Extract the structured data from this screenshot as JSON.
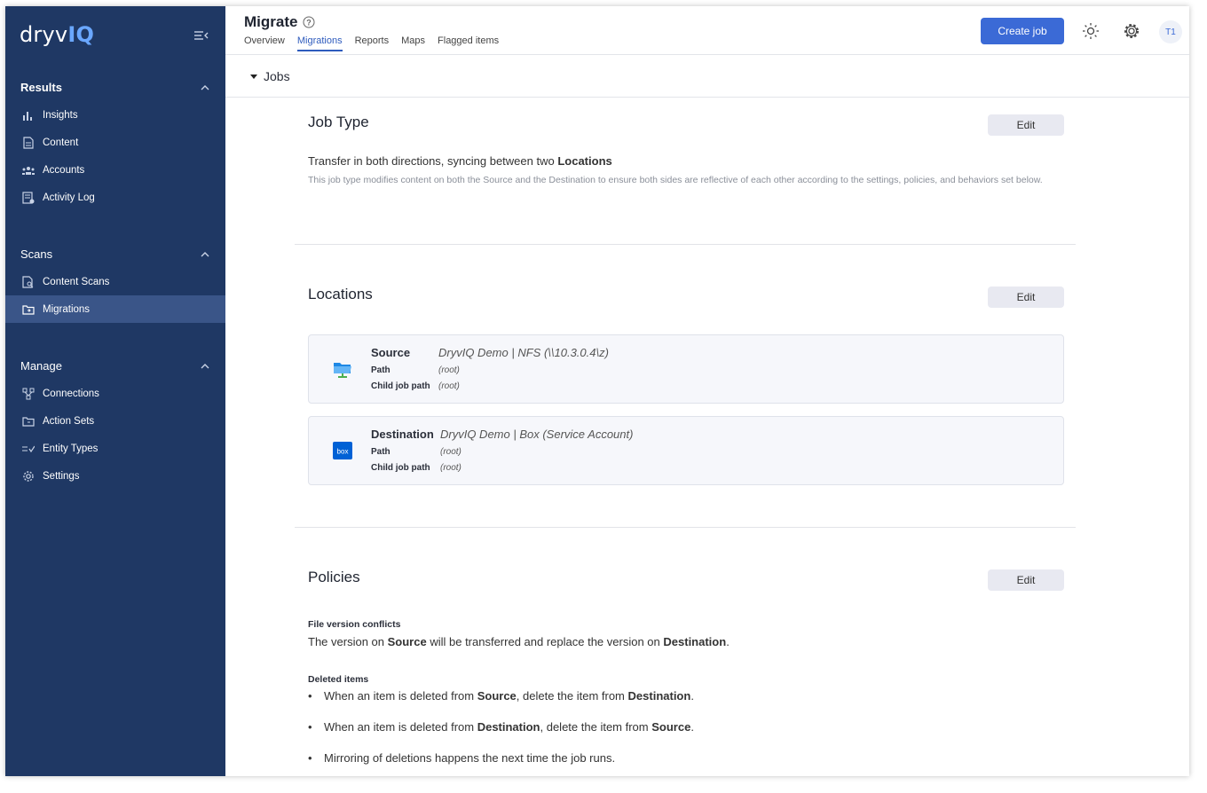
{
  "app": {
    "logo_part1": "dryv",
    "logo_part2": "IQ"
  },
  "sidebar": {
    "results_heading": "Results",
    "results_items": [
      {
        "label": "Insights",
        "icon": "bar-chart-icon"
      },
      {
        "label": "Content",
        "icon": "document-icon"
      },
      {
        "label": "Accounts",
        "icon": "people-icon"
      },
      {
        "label": "Activity Log",
        "icon": "log-icon"
      }
    ],
    "scans_heading": "Scans",
    "scans_items": [
      {
        "label": "Content Scans",
        "icon": "scan-icon"
      },
      {
        "label": "Migrations",
        "icon": "migration-icon",
        "active": true
      }
    ],
    "manage_heading": "Manage",
    "manage_items": [
      {
        "label": "Connections",
        "icon": "connections-icon"
      },
      {
        "label": "Action Sets",
        "icon": "action-set-icon"
      },
      {
        "label": "Entity Types",
        "icon": "entity-types-icon"
      },
      {
        "label": "Settings",
        "icon": "gear-icon"
      }
    ]
  },
  "header": {
    "title": "Migrate",
    "tabs": [
      "Overview",
      "Migrations",
      "Reports",
      "Maps",
      "Flagged items"
    ],
    "active_tab": "Migrations",
    "create_button": "Create job",
    "avatar": "T1"
  },
  "jobs_toggle": "Jobs",
  "job_type": {
    "title": "Job Type",
    "edit": "Edit",
    "line_prefix": "Transfer in both directions, syncing between two",
    "line_bold": "Locations",
    "description": "This job type modifies content on both the Source and the Destination to ensure both sides are reflective of each other according to the settings, policies, and behaviors set below."
  },
  "locations": {
    "title": "Locations",
    "edit": "Edit",
    "source": {
      "label": "Source",
      "value": "DryvIQ Demo | NFS (\\\\10.3.0.4\\z)",
      "path_label": "Path",
      "path_value": "(root)",
      "child_label": "Child job path",
      "child_value": "(root)"
    },
    "destination": {
      "label": "Destination",
      "value": "DryvIQ Demo | Box (Service Account)",
      "icon_text": "box",
      "path_label": "Path",
      "path_value": "(root)",
      "child_label": "Child job path",
      "child_value": "(root)"
    }
  },
  "policies": {
    "title": "Policies",
    "edit": "Edit",
    "conflicts_label": "File version conflicts",
    "conflicts_text": {
      "p1": "The version on",
      "b1": "Source",
      "p2": "will be transferred and replace the version on",
      "b2": "Destination",
      "p3": "."
    },
    "deleted_label": "Deleted items",
    "deleted_items": [
      {
        "p1": "When an item is deleted from",
        "b1": "Source",
        "p2": ", delete the item from",
        "b2": "Destination",
        "p3": "."
      },
      {
        "p1": "When an item is deleted from",
        "b1": "Destination",
        "p2": ", delete the item from",
        "b2": "Source",
        "p3": "."
      },
      {
        "p1": "Mirroring of deletions happens the next time the job runs.",
        "b1": "",
        "p2": "",
        "b2": "",
        "p3": ""
      }
    ]
  },
  "colors": {
    "sidebar": "#1f3864",
    "accent": "#3b6ad6",
    "active_nav": "#3a5588"
  }
}
